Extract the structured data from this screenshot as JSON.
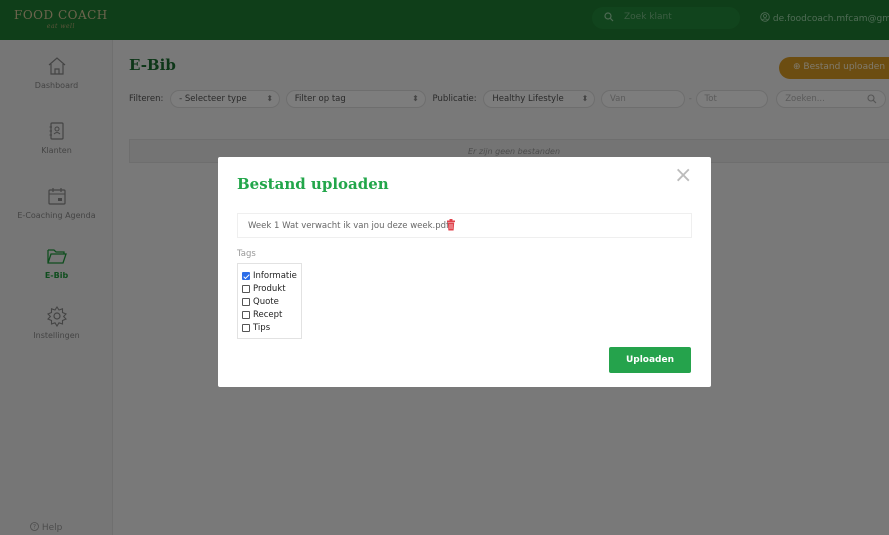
{
  "app": {
    "logo_text": "FOOD COACH",
    "logo_tagline": "eat well"
  },
  "topbar": {
    "search_placeholder": "Zoek klant",
    "user_email": "de.foodcoach.mfcam@gmail."
  },
  "sidebar": {
    "items": [
      {
        "label": "Dashboard",
        "icon": "home-icon"
      },
      {
        "label": "Klanten",
        "icon": "contacts-icon"
      },
      {
        "label": "E-Coaching Agenda",
        "icon": "calendar-icon"
      },
      {
        "label": "E-Bib",
        "icon": "folder-icon",
        "active": true
      },
      {
        "label": "Instellingen",
        "icon": "gear-icon"
      }
    ],
    "help_label": "Help"
  },
  "main": {
    "title": "E-Bib",
    "upload_button": "Bestand uploaden",
    "filters": {
      "label": "Filteren:",
      "type_select": "- Selecteer type",
      "tag_select": "Filter op tag",
      "publicatie_label": "Publicatie:",
      "publicatie_select": "Healthy Lifestyle",
      "van_placeholder": "Van",
      "tot_placeholder": "Tot",
      "search_placeholder": "Zoeken..."
    },
    "empty_text": "Er zijn geen bestanden"
  },
  "modal": {
    "title": "Bestand uploaden",
    "close": "×",
    "file_name": "Week 1 Wat verwacht ik van jou deze week.pdf",
    "tags_label": "Tags",
    "tags": [
      {
        "label": "Informatie",
        "checked": true
      },
      {
        "label": "Produkt",
        "checked": false
      },
      {
        "label": "Quote",
        "checked": false
      },
      {
        "label": "Recept",
        "checked": false
      },
      {
        "label": "Tips",
        "checked": false
      }
    ],
    "submit_label": "Uploaden"
  },
  "colors": {
    "brand_green": "#1e7d33",
    "accent_orange": "#d99a22",
    "button_green": "#25a34c"
  }
}
